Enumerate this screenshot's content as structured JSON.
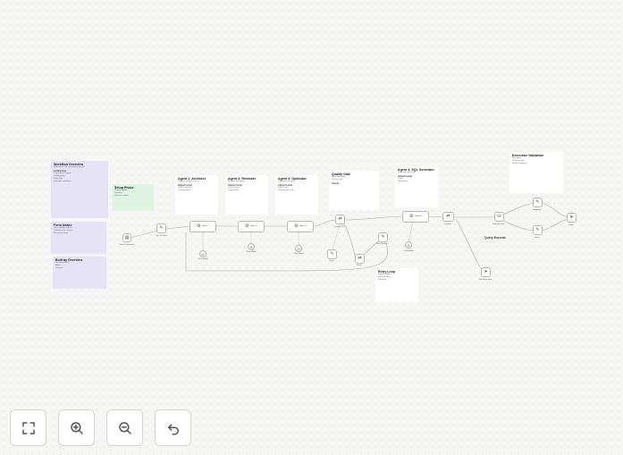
{
  "notes": {
    "workflow_overview": {
      "title": "Workflow Overview",
      "lines": [
        "Multi-agent SQL generation pipeline",
        "Architecture",
        "4 specialized agents",
        "Quality gates",
        "Retry loop",
        "Execution validation"
      ]
    },
    "form_intake": {
      "title": "Form Intake",
      "lines": [
        "User submits request",
        "Question and context",
        "Passed to setup"
      ]
    },
    "built_by": {
      "title": "Built by Overview",
      "lines": [
        "Documentation",
        "Author",
        "Contact"
      ]
    },
    "setup_phase": {
      "title": "Setup Phase",
      "lines": [
        "Prepare inputs",
        "Variables",
        "Schema context"
      ]
    },
    "agent1": {
      "title": "Agent 1: Architect",
      "lines": [
        "Designs query structure",
        "Output format",
        "Tables and joins",
        "Considerations"
      ]
    },
    "agent2": {
      "title": "Agent 2: Reviewer",
      "lines": [
        "Reviews the design",
        "Output format",
        "Issues found",
        "Suggestions"
      ]
    },
    "agent3": {
      "title": "Agent 3: Optimizer",
      "lines": [
        "Optimizes the plan",
        "Output format",
        "Index usage",
        "Performance notes"
      ]
    },
    "quality_gate": {
      "title": "Quality Gate",
      "lines": [
        "Score threshold",
        "Pass or retry",
        "Checks"
      ]
    },
    "agent4": {
      "title": "Agent 4: SQL Generator",
      "lines": [
        "Generates final SQL",
        "Output format",
        "Query",
        "Explanation"
      ]
    },
    "retry_loop": {
      "title": "Retry Loop",
      "lines": [
        "Handles failures",
        "Max attempts",
        "Feedback"
      ]
    },
    "execution_validation": {
      "title": "Execution Validation",
      "lines": [
        "Run query",
        "Check results",
        "Return response"
      ]
    }
  },
  "nodes": {
    "form": "Form Submission",
    "set_vars": "Set Variables",
    "agent1": "Agent 1",
    "agent2": "Agent 2",
    "agent3": "Agent 3",
    "model1": "Chat Model",
    "model2": "Chat Model",
    "model3": "Chat Model",
    "quality_if": "Quality OK?",
    "score_code": "Score",
    "retry_set": "Retry",
    "agent4": "Agent 4",
    "model4": "Chat Model",
    "format": "Format",
    "max_retry": "Max Retries?",
    "execute": "Execute SQL",
    "respond_ok": "Respond",
    "respond_err": "Error",
    "final": "Done",
    "fail_response": "Fail Response"
  },
  "labels": {
    "query_execute": "Query Execute"
  },
  "controls": {
    "fit_icon": "fit-view-icon",
    "zoom_in_icon": "zoom-in-icon",
    "zoom_out_icon": "zoom-out-icon",
    "undo_icon": "undo-icon"
  }
}
